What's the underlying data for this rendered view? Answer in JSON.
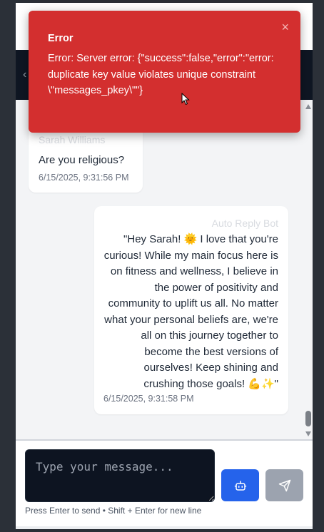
{
  "toast": {
    "title": "Error",
    "message": "Error: Server error: {\"success\":false,\"error\":\"error: duplicate key value violates unique constraint \\\"messages_pkey\\\"\"}",
    "close_label": "×"
  },
  "messages": [
    {
      "sender": "Sarah Williams",
      "text": "Are you religious?",
      "time": "6/15/2025, 9:31:56 PM",
      "direction": "incoming"
    },
    {
      "sender": "Auto Reply Bot",
      "text": "\"Hey Sarah! 🌞 I love that you're curious! While my main focus here is on fitness and wellness, I believe in the power of positivity and community to uplift us all. No matter what your personal beliefs are, we're all on this journey together to become the best versions of ourselves! Keep shining and crushing those goals! 💪✨\"",
      "time": "6/15/2025, 9:31:58 PM",
      "direction": "outgoing"
    }
  ],
  "composer": {
    "placeholder": "Type your message...",
    "hint": "Press Enter to send • Shift + Enter for new line"
  },
  "icons": {
    "bot_button": "robot-icon",
    "send_button": "send-icon",
    "back": "back-arrow-icon"
  },
  "colors": {
    "toast_bg": "#d32f2f",
    "bot_button": "#2563eb",
    "send_button": "#9ca3af",
    "input_bg": "#0d1421",
    "header_bg": "#0f1623"
  }
}
